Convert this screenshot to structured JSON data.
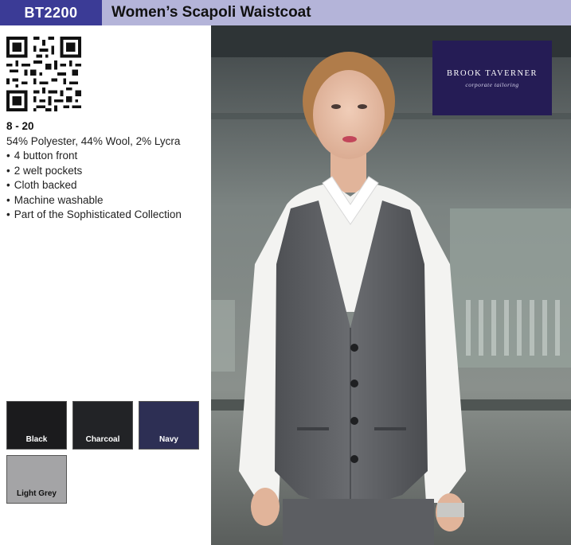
{
  "header": {
    "code": "BT2200",
    "title": "Women’s Scapoli Waistcoat"
  },
  "product": {
    "sizes": "8 - 20",
    "fabric": "54% Polyester, 44% Wool, 2% Lycra",
    "features": [
      "4 button front",
      "2 welt pockets",
      "Cloth backed",
      "Machine washable",
      "Part of the Sophisticated Collection"
    ]
  },
  "colours": [
    {
      "name": "Black",
      "hex": "#1b1b1d",
      "text": "#ffffff"
    },
    {
      "name": "Charcoal",
      "hex": "#222326",
      "text": "#ffffff"
    },
    {
      "name": "Navy",
      "hex": "#2d2f54",
      "text": "#ffffff"
    },
    {
      "name": "Light Grey",
      "hex": "#a4a4a6",
      "text": "#111111"
    }
  ],
  "logo": {
    "name": "BROOK TAVERNER",
    "tagline": "corporate tailoring"
  },
  "accent_colors": {
    "header_band": "#b4b4d9",
    "code_box": "#3b3b96",
    "logo_box": "#251c55"
  }
}
